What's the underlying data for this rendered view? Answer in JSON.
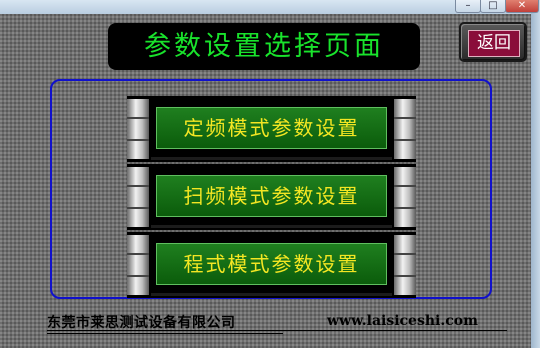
{
  "window": {
    "minimize_icon": "–",
    "maximize_icon": "□",
    "close_icon": "✕"
  },
  "header": {
    "title": "参数设置选择页面",
    "back_label": "返回"
  },
  "menu": {
    "items": [
      {
        "label": "定频模式参数设置"
      },
      {
        "label": "扫频模式参数设置"
      },
      {
        "label": "程式模式参数设置"
      }
    ]
  },
  "footer": {
    "company": "东莞市莱思测试设备有限公司",
    "website": "www.laisiceshi.com"
  },
  "colors": {
    "title_text": "#19e32c",
    "menu_text": "#f3e623",
    "menu_fill": "#1f7f1f",
    "back_fill": "#8a0d3a",
    "panel_border": "#1010cc"
  }
}
